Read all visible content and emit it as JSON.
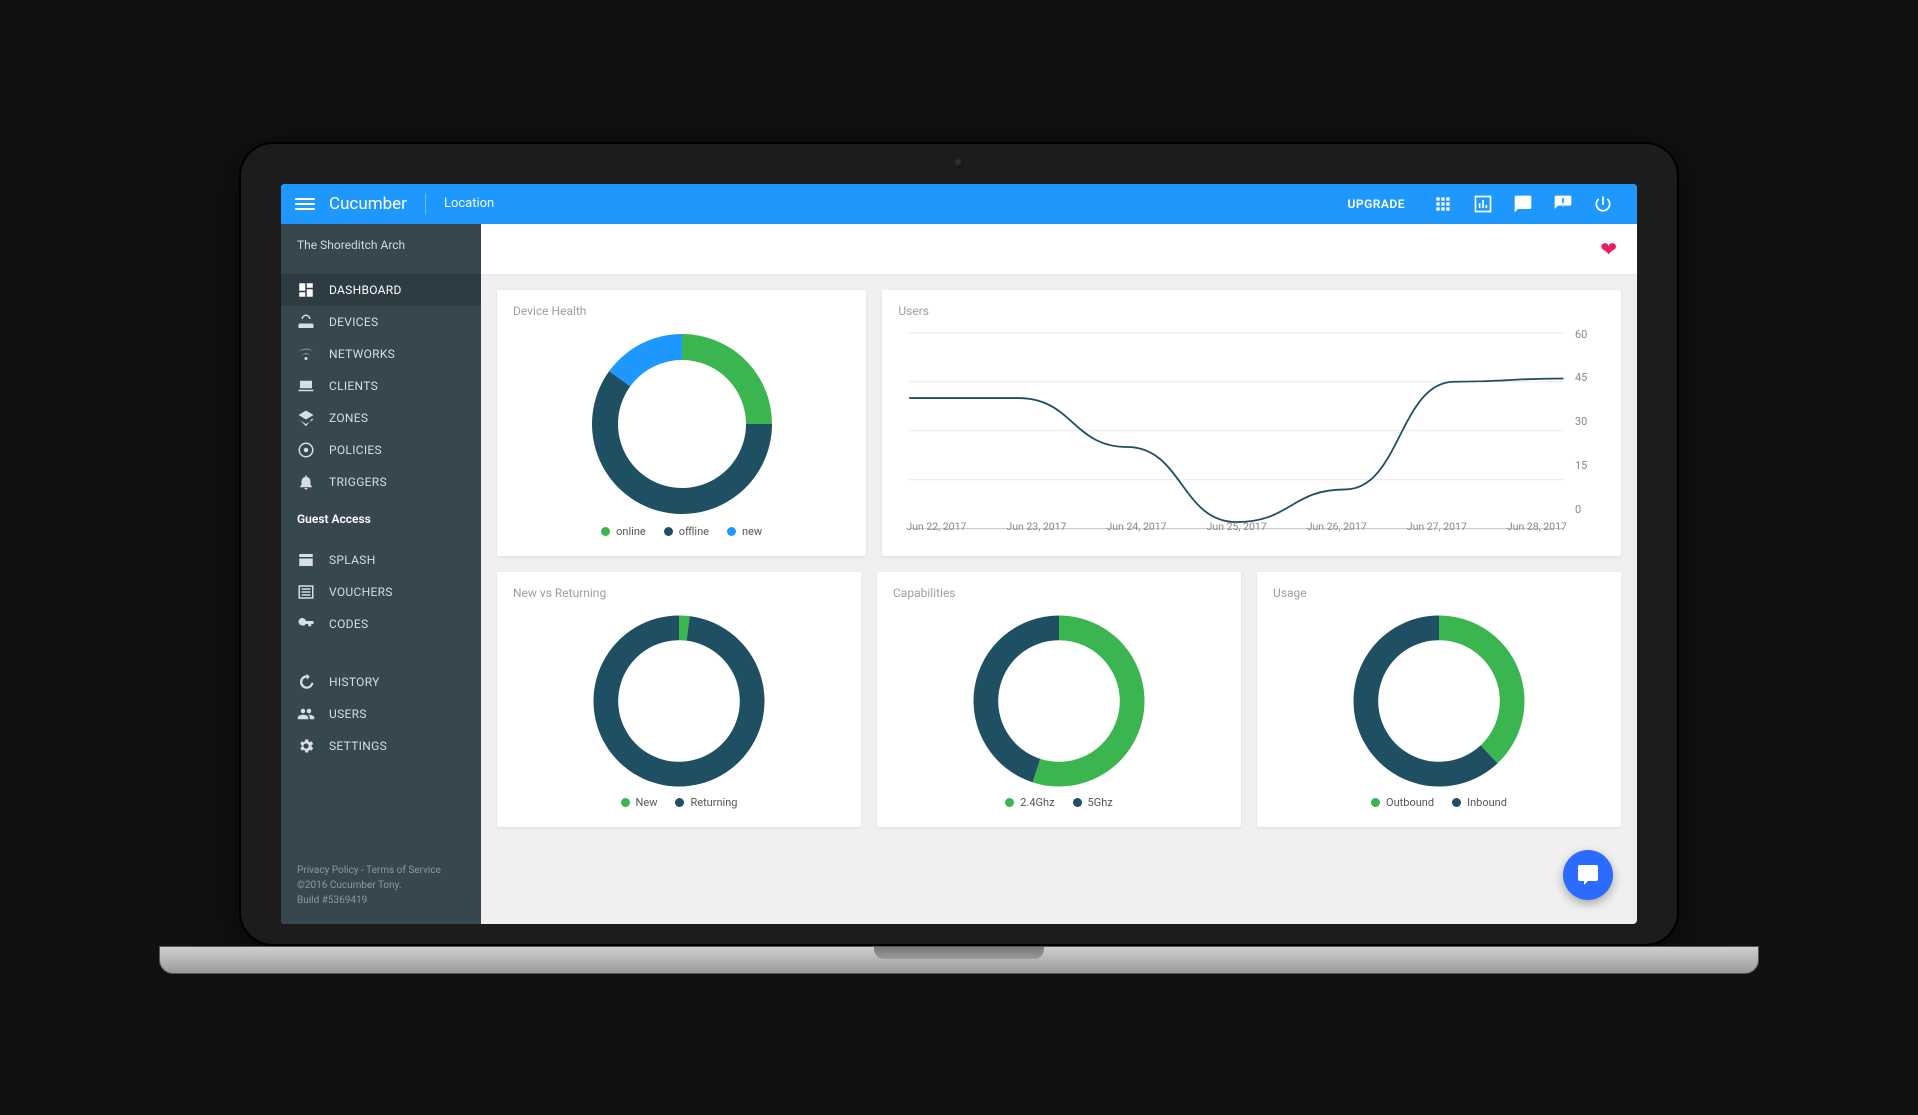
{
  "header": {
    "brand": "Cucumber",
    "crumb": "Location",
    "upgrade": "UPGRADE"
  },
  "sidebar": {
    "location": "The Shoreditch Arch",
    "nav_main": [
      {
        "label": "DASHBOARD"
      },
      {
        "label": "DEVICES"
      },
      {
        "label": "NETWORKS"
      },
      {
        "label": "CLIENTS"
      },
      {
        "label": "ZONES"
      },
      {
        "label": "POLICIES"
      },
      {
        "label": "TRIGGERS"
      }
    ],
    "guest_access_title": "Guest Access",
    "nav_guest": [
      {
        "label": "SPLASH"
      },
      {
        "label": "VOUCHERS"
      },
      {
        "label": "CODES"
      }
    ],
    "nav_bottom": [
      {
        "label": "HISTORY"
      },
      {
        "label": "USERS"
      },
      {
        "label": "SETTINGS"
      }
    ],
    "footer": {
      "links": "Privacy Policy - Terms of Service",
      "copyright": "©2016 Cucumber Tony.",
      "build": "Build #5369419"
    }
  },
  "cards": {
    "device_health": {
      "title": "Device Health"
    },
    "users": {
      "title": "Users"
    },
    "nvr": {
      "title": "New vs Returning"
    },
    "capabilities": {
      "title": "Capabilities"
    },
    "usage": {
      "title": "Usage"
    }
  },
  "colors": {
    "green": "#3ab550",
    "teal": "#1e4f63",
    "blue": "#1e98fc"
  },
  "chart_data": [
    {
      "id": "device_health",
      "type": "pie",
      "title": "Device Health",
      "series": [
        {
          "name": "online",
          "value": 25,
          "color": "#3ab550"
        },
        {
          "name": "offline",
          "value": 60,
          "color": "#1e4f63"
        },
        {
          "name": "new",
          "value": 15,
          "color": "#1e98fc"
        }
      ]
    },
    {
      "id": "users",
      "type": "line",
      "title": "Users",
      "ylabel": "",
      "ylim": [
        0,
        60
      ],
      "yticks": [
        0,
        15,
        30,
        45,
        60
      ],
      "categories": [
        "Jun 22, 2017",
        "Jun 23, 2017",
        "Jun 24, 2017",
        "Jun 25, 2017",
        "Jun 26, 2017",
        "Jun 27, 2017",
        "Jun 28, 2017"
      ],
      "values": [
        40,
        40,
        25,
        2,
        12,
        45,
        46
      ]
    },
    {
      "id": "new_vs_returning",
      "type": "pie",
      "title": "New vs Returning",
      "series": [
        {
          "name": "New",
          "value": 2,
          "color": "#3ab550"
        },
        {
          "name": "Returning",
          "value": 98,
          "color": "#1e4f63"
        }
      ]
    },
    {
      "id": "capabilities",
      "type": "pie",
      "title": "Capabilities",
      "series": [
        {
          "name": "2.4Ghz",
          "value": 55,
          "color": "#3ab550"
        },
        {
          "name": "5Ghz",
          "value": 45,
          "color": "#1e4f63"
        }
      ]
    },
    {
      "id": "usage",
      "type": "pie",
      "title": "Usage",
      "series": [
        {
          "name": "Outbound",
          "value": 38,
          "color": "#3ab550"
        },
        {
          "name": "Inbound",
          "value": 62,
          "color": "#1e4f63"
        }
      ]
    }
  ]
}
